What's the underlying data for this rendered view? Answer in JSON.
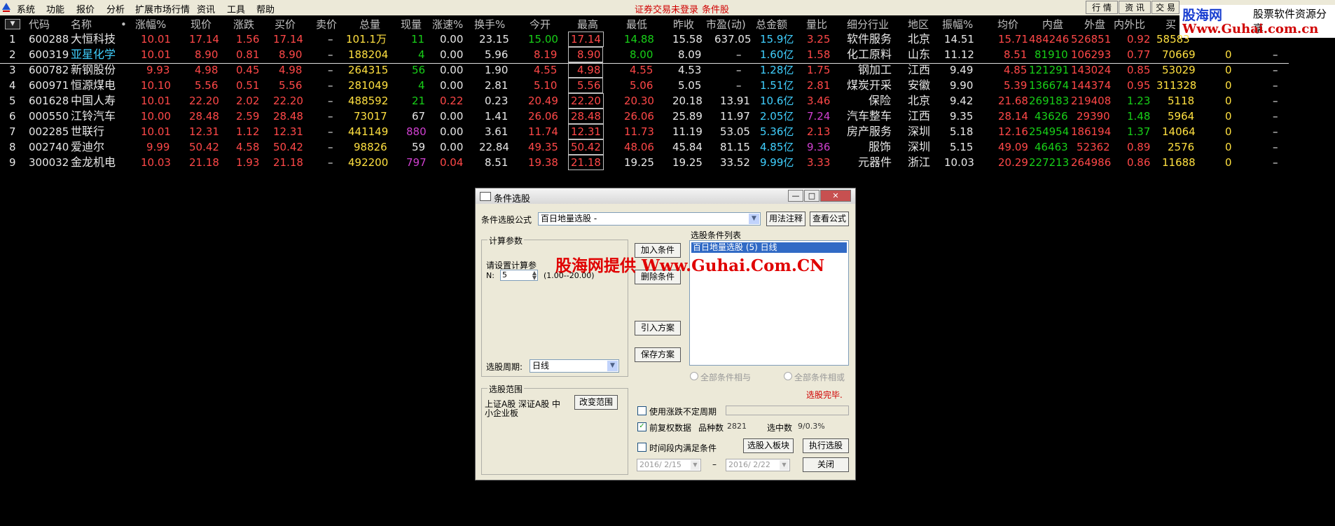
{
  "menubar": {
    "items": [
      "系统",
      "功能",
      "报价",
      "分析",
      "扩展市场行情",
      "资讯",
      "工具",
      "帮助"
    ],
    "status_left": "证券交易未登录",
    "status_right": "条件股",
    "right_buttons": [
      "行 情",
      "资 讯",
      "交 易"
    ]
  },
  "logo": {
    "line1": "股海网",
    "line2": "股票软件资源分享",
    "line3": "Www.Guhai.com.cn"
  },
  "table": {
    "sort_icon": "triangle-down-icon",
    "headers": [
      "代码",
      "名称",
      "•",
      "涨幅%",
      "现价",
      "涨跌",
      "买价",
      "卖价",
      "总量",
      "现量",
      "涨速%",
      "换手%",
      "今开",
      "最高",
      "最低",
      "昨收",
      "市盈(动)",
      "总金额",
      "量比",
      "细分行业",
      "地区",
      "振幅%",
      "均价",
      "内盘",
      "外盘",
      "内外比",
      "买"
    ],
    "rows": [
      {
        "idx": "1",
        "code": "600288",
        "name": "大恒科技",
        "chg_pct": "10.01",
        "price": "17.14",
        "chg": "1.56",
        "bid": "17.14",
        "ask": "–",
        "vol": "101.1万",
        "cur_vol": "11",
        "speed": "0.00",
        "turnover": "23.15",
        "open": "15.00",
        "high": "17.14",
        "low": "14.88",
        "prev": "15.58",
        "pe": "637.05",
        "amount": "15.9亿",
        "vol_ratio": "3.25",
        "industry": "软件服务",
        "region": "北京",
        "amplitude": "14.51",
        "avg": "15.71",
        "inner": "484246",
        "outer": "526851",
        "io_ratio": "0.92",
        "buy": "58583"
      },
      {
        "idx": "2",
        "code": "600319",
        "name": "亚星化学",
        "chg_pct": "10.01",
        "price": "8.90",
        "chg": "0.81",
        "bid": "8.90",
        "ask": "–",
        "vol": "188204",
        "cur_vol": "4",
        "speed": "0.00",
        "turnover": "5.96",
        "open": "8.19",
        "high": "8.90",
        "low": "8.00",
        "prev": "8.09",
        "pe": "–",
        "amount": "1.60亿",
        "vol_ratio": "1.58",
        "industry": "化工原料",
        "region": "山东",
        "amplitude": "11.12",
        "avg": "8.51",
        "inner": "81910",
        "outer": "106293",
        "io_ratio": "0.77",
        "buy": "70669",
        "x1": "0",
        "x2": "–"
      },
      {
        "idx": "3",
        "code": "600782",
        "name": "新钢股份",
        "chg_pct": "9.93",
        "price": "4.98",
        "chg": "0.45",
        "bid": "4.98",
        "ask": "–",
        "vol": "264315",
        "cur_vol": "56",
        "speed": "0.00",
        "turnover": "1.90",
        "open": "4.55",
        "high": "4.98",
        "low": "4.55",
        "prev": "4.53",
        "pe": "–",
        "amount": "1.28亿",
        "vol_ratio": "1.75",
        "industry": "钢加工",
        "region": "江西",
        "amplitude": "9.49",
        "avg": "4.85",
        "inner": "121291",
        "outer": "143024",
        "io_ratio": "0.85",
        "buy": "53029",
        "x1": "0",
        "x2": "–"
      },
      {
        "idx": "4",
        "code": "600971",
        "name": "恒源煤电",
        "chg_pct": "10.10",
        "price": "5.56",
        "chg": "0.51",
        "bid": "5.56",
        "ask": "–",
        "vol": "281049",
        "cur_vol": "4",
        "speed": "0.00",
        "turnover": "2.81",
        "open": "5.10",
        "high": "5.56",
        "low": "5.06",
        "prev": "5.05",
        "pe": "–",
        "amount": "1.51亿",
        "vol_ratio": "2.81",
        "industry": "煤炭开采",
        "region": "安徽",
        "amplitude": "9.90",
        "avg": "5.39",
        "inner": "136674",
        "outer": "144374",
        "io_ratio": "0.95",
        "buy": "311328",
        "x1": "0",
        "x2": "–"
      },
      {
        "idx": "5",
        "code": "601628",
        "name": "中国人寿",
        "chg_pct": "10.01",
        "price": "22.20",
        "chg": "2.02",
        "bid": "22.20",
        "ask": "–",
        "vol": "488592",
        "cur_vol": "21",
        "speed": "0.22",
        "turnover": "0.23",
        "open": "20.49",
        "high": "22.20",
        "low": "20.30",
        "prev": "20.18",
        "pe": "13.91",
        "amount": "10.6亿",
        "vol_ratio": "3.46",
        "industry": "保险",
        "region": "北京",
        "amplitude": "9.42",
        "avg": "21.68",
        "inner": "269183",
        "outer": "219408",
        "io_ratio": "1.23",
        "buy": "5118",
        "x1": "0",
        "x2": "–"
      },
      {
        "idx": "6",
        "code": "000550",
        "name": "江铃汽车",
        "chg_pct": "10.00",
        "price": "28.48",
        "chg": "2.59",
        "bid": "28.48",
        "ask": "–",
        "vol": "73017",
        "cur_vol": "67",
        "speed": "0.00",
        "turnover": "1.41",
        "open": "26.06",
        "high": "28.48",
        "low": "26.06",
        "prev": "25.89",
        "pe": "11.97",
        "amount": "2.05亿",
        "vol_ratio": "7.24",
        "industry": "汽车整车",
        "region": "江西",
        "amplitude": "9.35",
        "avg": "28.14",
        "inner": "43626",
        "outer": "29390",
        "io_ratio": "1.48",
        "buy": "5964",
        "x1": "0",
        "x2": "–"
      },
      {
        "idx": "7",
        "code": "002285",
        "name": "世联行",
        "chg_pct": "10.01",
        "price": "12.31",
        "chg": "1.12",
        "bid": "12.31",
        "ask": "–",
        "vol": "441149",
        "cur_vol": "880",
        "speed": "0.00",
        "turnover": "3.61",
        "open": "11.74",
        "high": "12.31",
        "low": "11.73",
        "prev": "11.19",
        "pe": "53.05",
        "amount": "5.36亿",
        "vol_ratio": "2.13",
        "industry": "房产服务",
        "region": "深圳",
        "amplitude": "5.18",
        "avg": "12.16",
        "inner": "254954",
        "outer": "186194",
        "io_ratio": "1.37",
        "buy": "14064",
        "x1": "0",
        "x2": "–"
      },
      {
        "idx": "8",
        "code": "002740",
        "name": "爱迪尔",
        "chg_pct": "9.99",
        "price": "50.42",
        "chg": "4.58",
        "bid": "50.42",
        "ask": "–",
        "vol": "98826",
        "cur_vol": "59",
        "speed": "0.00",
        "turnover": "22.84",
        "open": "49.35",
        "high": "50.42",
        "low": "48.06",
        "prev": "45.84",
        "pe": "81.15",
        "amount": "4.85亿",
        "vol_ratio": "9.36",
        "industry": "服饰",
        "region": "深圳",
        "amplitude": "5.15",
        "avg": "49.09",
        "inner": "46463",
        "outer": "52362",
        "io_ratio": "0.89",
        "buy": "2576",
        "x1": "0",
        "x2": "–"
      },
      {
        "idx": "9",
        "code": "300032",
        "name": "金龙机电",
        "chg_pct": "10.03",
        "price": "21.18",
        "chg": "1.93",
        "bid": "21.18",
        "ask": "–",
        "vol": "492200",
        "cur_vol": "797",
        "speed": "0.04",
        "turnover": "8.51",
        "open": "19.38",
        "high": "21.18",
        "low": "19.25",
        "prev": "19.25",
        "pe": "33.52",
        "amount": "9.99亿",
        "vol_ratio": "3.33",
        "industry": "元器件",
        "region": "浙江",
        "amplitude": "10.03",
        "avg": "20.29",
        "inner": "227213",
        "outer": "264986",
        "io_ratio": "0.86",
        "buy": "11688",
        "x1": "0",
        "x2": "–"
      }
    ]
  },
  "dialog": {
    "title": "条件选股",
    "formula_label": "条件选股公式",
    "formula_value": "百日地量选股 -",
    "usage_button": "用法注释",
    "view_formula_button": "查看公式",
    "params_group": "计算参数",
    "params_prompt": "请设置计算参",
    "param_n_label": "N:",
    "param_n_value": "5",
    "param_n_range": "(1.00--20.00)",
    "add_button": "加入条件",
    "delete_button": "删除条件",
    "import_button": "引入方案",
    "save_button": "保存方案",
    "list_label": "选股条件列表",
    "list_item": "百日地量选股  (5)  日线",
    "period_label": "选股周期:",
    "period_value": "日线",
    "radio_and": "全部条件相与",
    "radio_or": "全部条件相或",
    "done_text": "选股完毕.",
    "range_group": "选股范围",
    "range_text_1": "上证A股 深证A股 中",
    "range_text_2": "小企业板",
    "change_range_button": "改变范围",
    "use_uncertain_label": "使用涨跌不定周期",
    "pre_adjust_label": "前复权数据",
    "count_label": "品种数",
    "count_value": "2821",
    "selected_label": "选中数",
    "selected_value": "9/0.3%",
    "period_cond_label": "时间段内满足条件",
    "to_board_button": "选股入板块",
    "execute_button": "执行选股",
    "date_from": "2016/ 2/15",
    "date_sep": "–",
    "date_to": "2016/ 2/22",
    "close_button": "关闭"
  },
  "watermark": "股海网提供 Www.Guhai.Com.CN"
}
